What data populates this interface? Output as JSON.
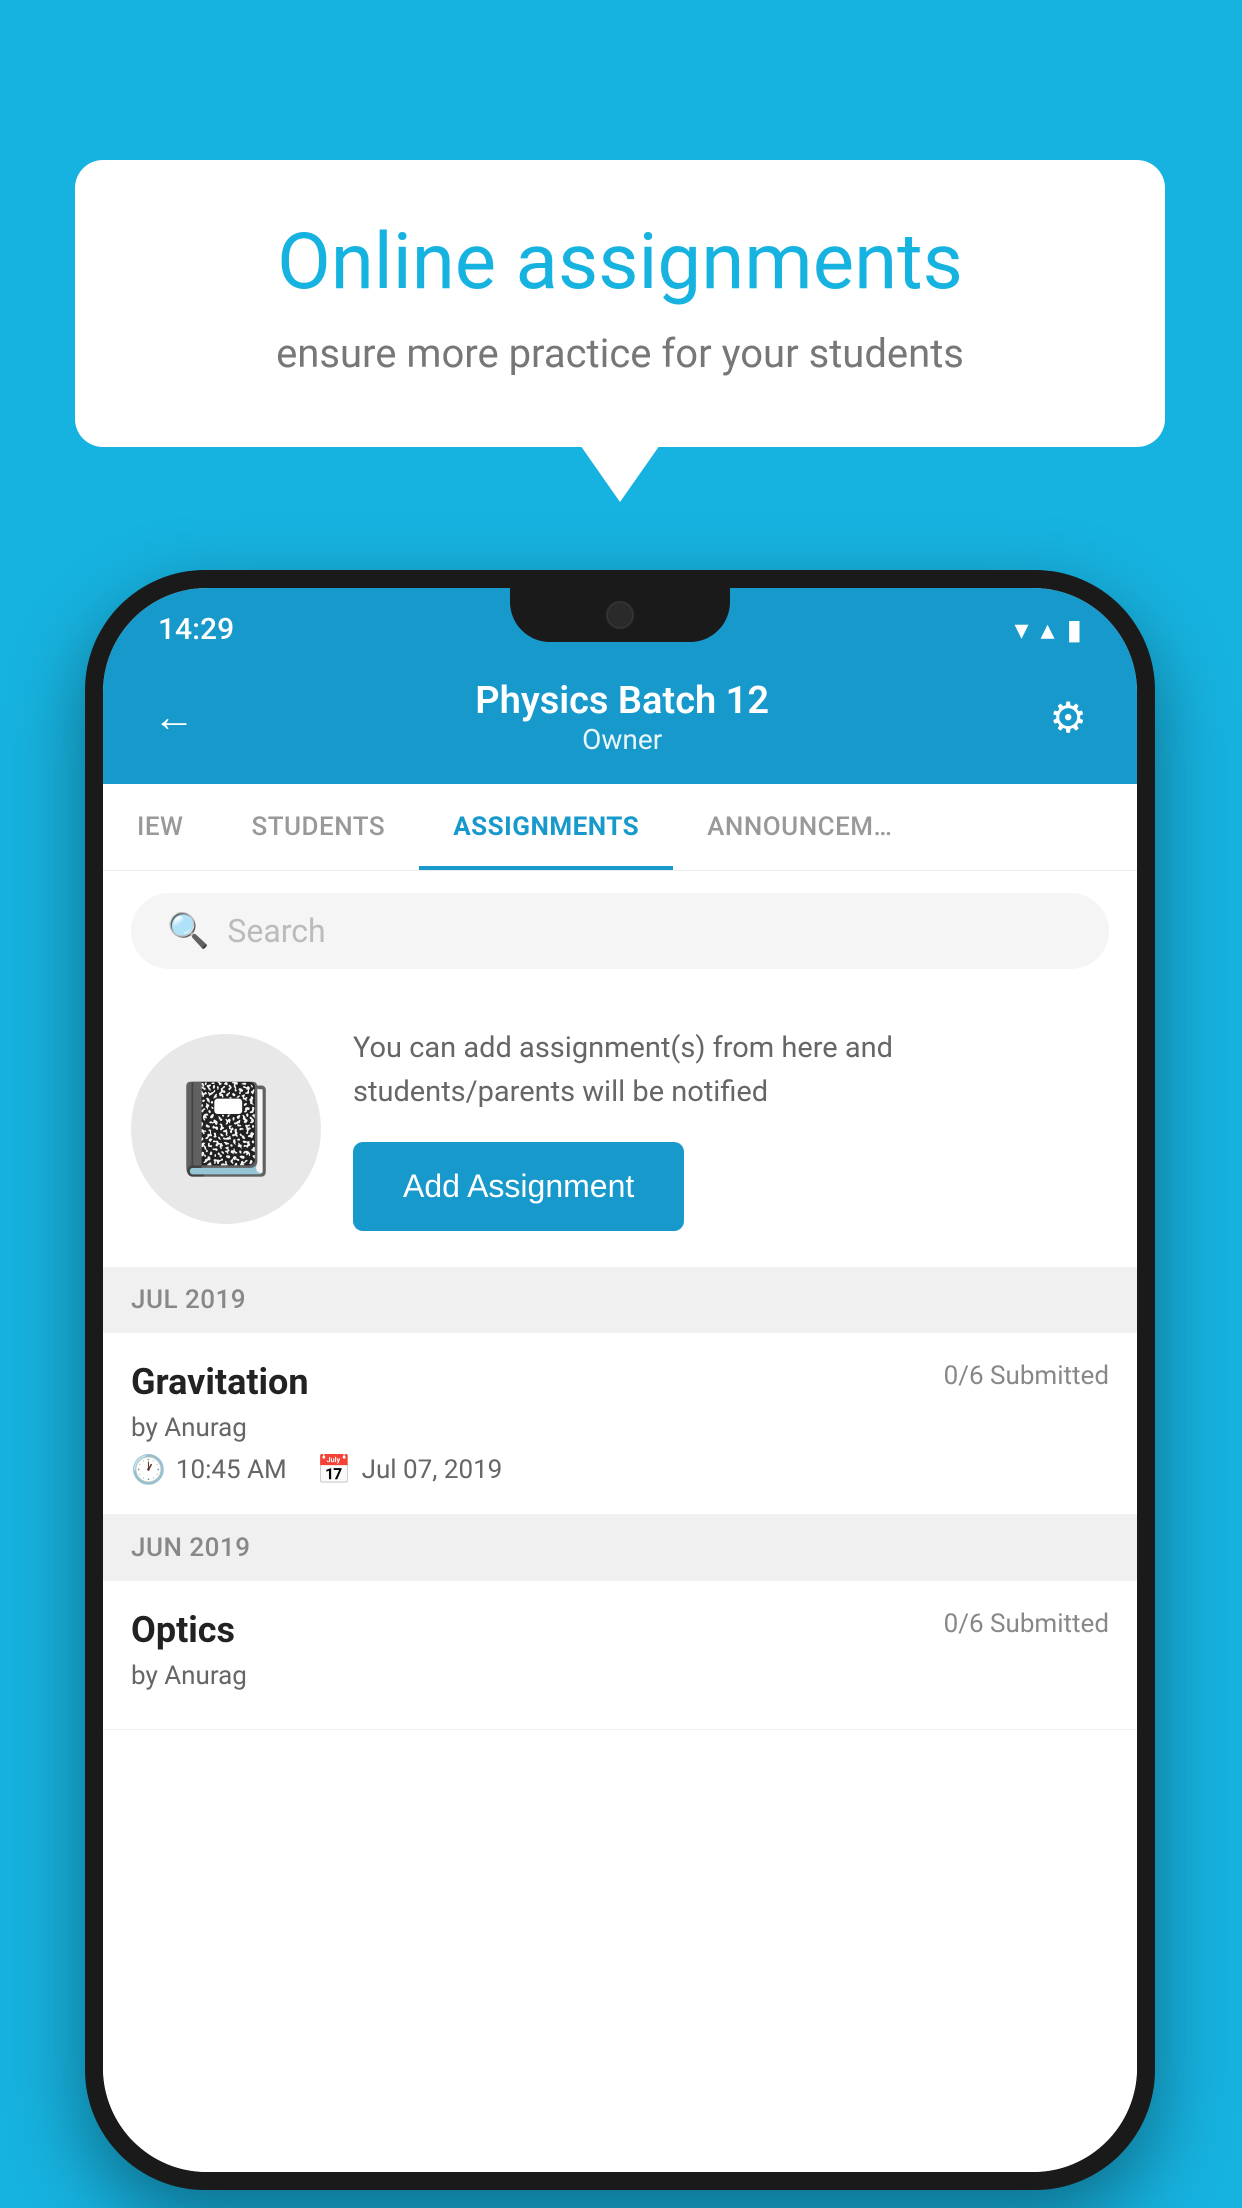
{
  "background": {
    "color": "#17B3E0"
  },
  "speech_bubble": {
    "title": "Online assignments",
    "subtitle": "ensure more practice for your students"
  },
  "phone": {
    "status_bar": {
      "time": "14:29",
      "wifi": "▼",
      "signal": "▲",
      "battery": "▮"
    },
    "header": {
      "back_label": "←",
      "title": "Physics Batch 12",
      "subtitle": "Owner",
      "settings_label": "⚙"
    },
    "tabs": [
      {
        "label": "IEW",
        "active": false
      },
      {
        "label": "STUDENTS",
        "active": false
      },
      {
        "label": "ASSIGNMENTS",
        "active": true
      },
      {
        "label": "ANNOUNCEM…",
        "active": false
      }
    ],
    "search": {
      "placeholder": "Search"
    },
    "add_section": {
      "description": "You can add assignment(s) from here and students/parents will be notified",
      "button_label": "Add Assignment"
    },
    "sections": [
      {
        "month": "JUL 2019",
        "assignments": [
          {
            "name": "Gravitation",
            "submitted": "0/6 Submitted",
            "by": "by Anurag",
            "time": "10:45 AM",
            "date": "Jul 07, 2019"
          }
        ]
      },
      {
        "month": "JUN 2019",
        "assignments": [
          {
            "name": "Optics",
            "submitted": "0/6 Submitted",
            "by": "by Anurag",
            "time": "",
            "date": ""
          }
        ]
      }
    ]
  }
}
